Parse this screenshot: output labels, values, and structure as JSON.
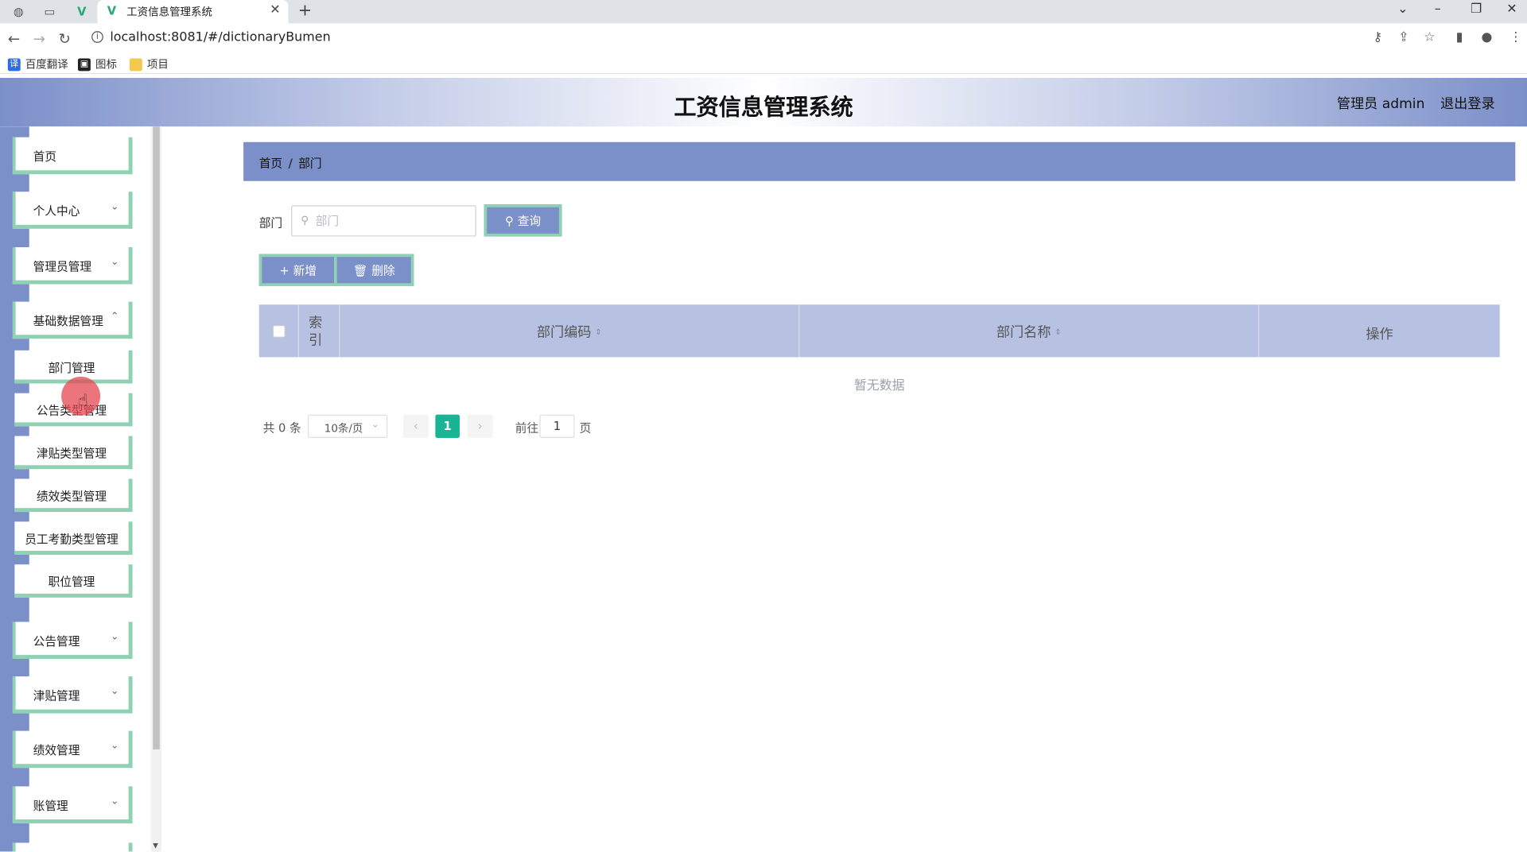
{
  "browser": {
    "tab_title": "工资信息管理系统",
    "url": "localhost:8081/#/dictionaryBumen",
    "bookmarks": [
      "百度翻译",
      "图标",
      "项目"
    ]
  },
  "header": {
    "title": "工资信息管理系统",
    "user_label": "管理员 admin",
    "logout_label": "退出登录"
  },
  "sidebar": {
    "menus_top": [
      {
        "label": "首页",
        "expandable": false
      },
      {
        "label": "个人中心",
        "expandable": true
      },
      {
        "label": "管理员管理",
        "expandable": true
      },
      {
        "label": "基础数据管理",
        "expandable": true
      }
    ],
    "submenu": [
      "部门管理",
      "公告类型管理",
      "津贴类型管理",
      "绩效类型管理",
      "员工考勤类型管理",
      "职位管理"
    ],
    "menus_bottom": [
      "公告管理",
      "津贴管理",
      "绩效管理",
      "账管理"
    ]
  },
  "breadcrumb": {
    "home": "首页",
    "separator": "/",
    "current": "部门"
  },
  "search": {
    "label": "部门",
    "placeholder": "部门",
    "value": "",
    "button_label": "查询"
  },
  "actions": {
    "add_label": "新增",
    "delete_label": "删除"
  },
  "table": {
    "columns": {
      "index": "索引",
      "code": "部门编码",
      "name": "部门名称",
      "action": "操作"
    },
    "rows": [],
    "empty_text": "暂无数据"
  },
  "pagination": {
    "total_text": "共 0 条",
    "page_size": "10条/页",
    "current_page": "1",
    "goto_label": "前往",
    "goto_value": "1",
    "page_suffix": "页"
  },
  "colors": {
    "accent": "#7b8fc9",
    "border_accent": "#8ed1b3",
    "active_page": "#1ab394"
  }
}
